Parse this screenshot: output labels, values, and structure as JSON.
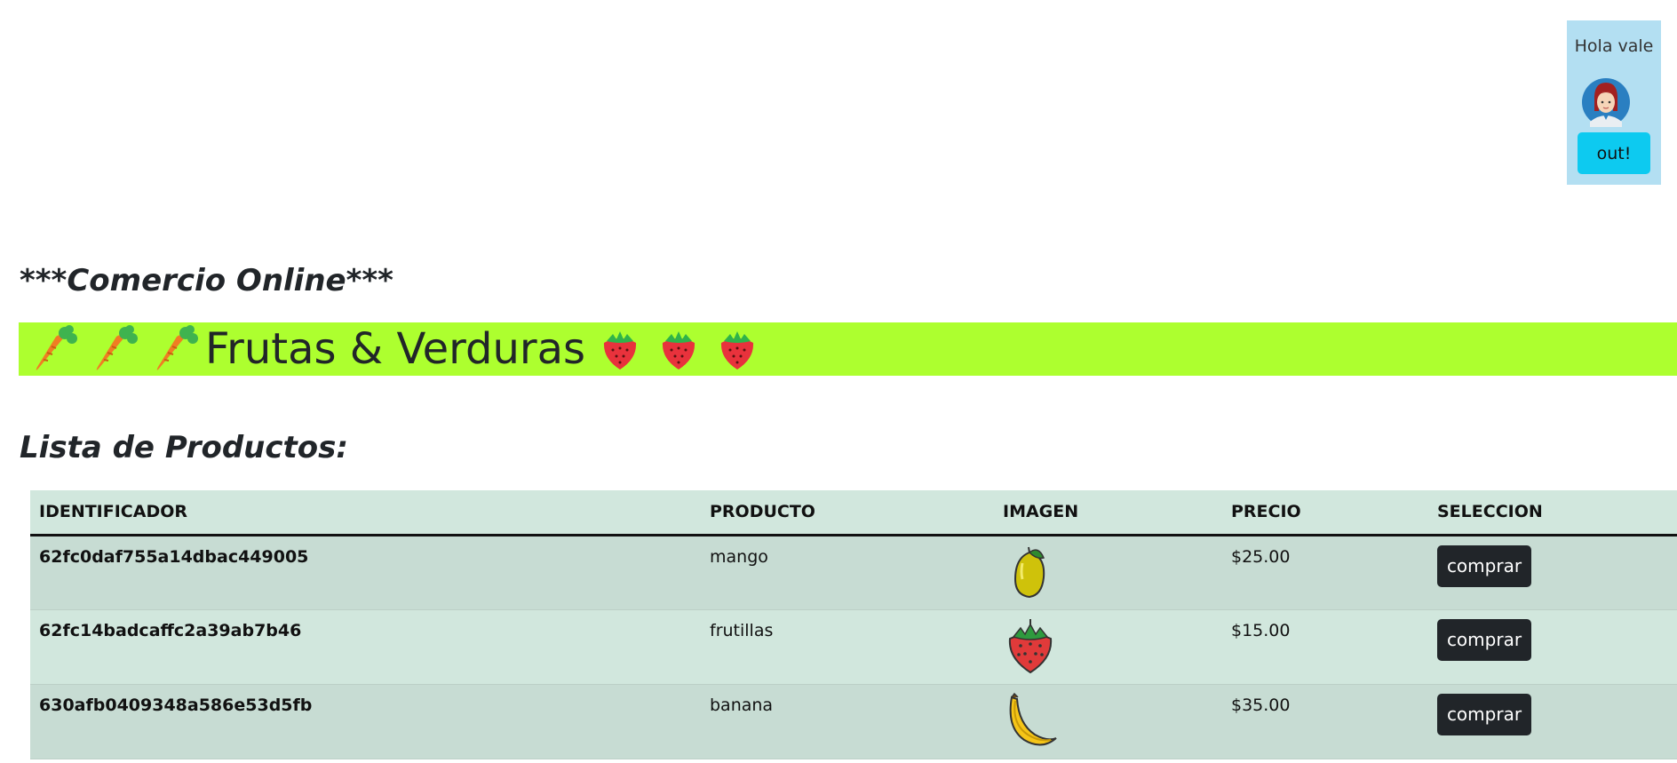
{
  "user": {
    "greeting": "Hola vale",
    "logout_label": "out!"
  },
  "store_title": "***Comercio Online***",
  "banner": {
    "title": "Frutas & Verduras",
    "background": "#adff2f",
    "left_icons": [
      "carrot-icon",
      "carrot-icon",
      "carrot-icon"
    ],
    "right_icons": [
      "strawberry-icon",
      "strawberry-icon",
      "strawberry-icon"
    ]
  },
  "list_title": "Lista de Productos:",
  "table": {
    "headers": [
      "IDENTIFICADOR",
      "PRODUCTO",
      "IMAGEN",
      "PRECIO",
      "SELECCION"
    ],
    "rows": [
      {
        "id": "62fc0daf755a14dbac449005",
        "product": "mango",
        "image": "mango-icon",
        "price": "$25.00",
        "action": "comprar"
      },
      {
        "id": "62fc14badcaffc2a39ab7b46",
        "product": "frutillas",
        "image": "strawberry-icon",
        "price": "$15.00",
        "action": "comprar"
      },
      {
        "id": "630afb0409348a586e53d5fb",
        "product": "banana",
        "image": "banana-icon",
        "price": "$35.00",
        "action": "comprar"
      }
    ]
  },
  "colors": {
    "user_box": "#b3dff2",
    "logout_button": "#0dcaf0",
    "buy_button": "#212529",
    "table_header": "#d1e7dd"
  }
}
